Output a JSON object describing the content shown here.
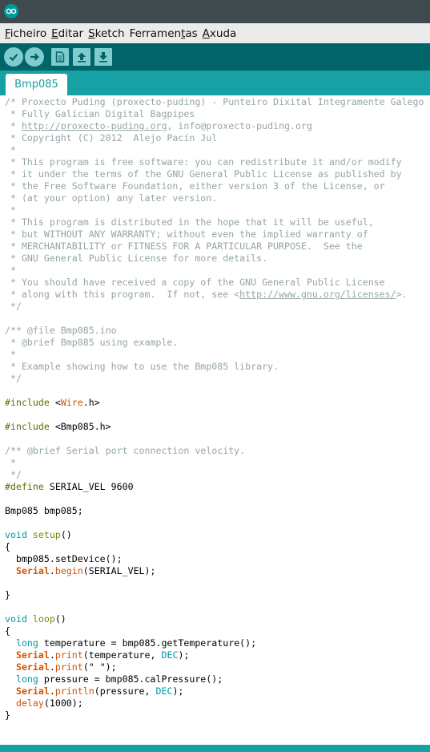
{
  "menu": {
    "items": [
      {
        "u": "F",
        "rest": "icheiro"
      },
      {
        "u": "E",
        "rest": "ditar"
      },
      {
        "u": "S",
        "rest": "ketch"
      },
      {
        "pre": "Ferramen",
        "u": "t",
        "rest": "as"
      },
      {
        "u": "A",
        "rest": "xuda"
      }
    ]
  },
  "tab": {
    "label": "Bmp085"
  },
  "code": [
    [
      [
        "c",
        "/* Proxecto Puding (proxecto-puding) - Punteiro Dixital Integramente Galego"
      ]
    ],
    [
      [
        "c",
        " * Fully Galician Digital Bagpipes"
      ]
    ],
    [
      [
        "c",
        " * "
      ],
      [
        "a",
        "http://proxecto-puding.org"
      ],
      [
        "c",
        ", info@proxecto-puding.org"
      ]
    ],
    [
      [
        "c",
        " * Copyright (C) 2012  Alejo Pacín Jul"
      ]
    ],
    [
      [
        "c",
        " *"
      ]
    ],
    [
      [
        "c",
        " * This program is free software: you can redistribute it and/or modify"
      ]
    ],
    [
      [
        "c",
        " * it under the terms of the GNU General Public License as published by"
      ]
    ],
    [
      [
        "c",
        " * the Free Software Foundation, either version 3 of the License, or"
      ]
    ],
    [
      [
        "c",
        " * (at your option) any later version."
      ]
    ],
    [
      [
        "c",
        " *"
      ]
    ],
    [
      [
        "c",
        " * This program is distributed in the hope that it will be useful,"
      ]
    ],
    [
      [
        "c",
        " * but WITHOUT ANY WARRANTY; without even the implied warranty of"
      ]
    ],
    [
      [
        "c",
        " * MERCHANTABILITY or FITNESS FOR A PARTICULAR PURPOSE.  See the"
      ]
    ],
    [
      [
        "c",
        " * GNU General Public License for more details."
      ]
    ],
    [
      [
        "c",
        " *"
      ]
    ],
    [
      [
        "c",
        " * You should have received a copy of the GNU General Public License"
      ]
    ],
    [
      [
        "c",
        " * along with this program.  If not, see <"
      ],
      [
        "a",
        "http://www.gnu.org/licenses/"
      ],
      [
        "c",
        ">."
      ]
    ],
    [
      [
        "c",
        " */"
      ]
    ],
    [],
    [
      [
        "c",
        "/** @file Bmp085.ino"
      ]
    ],
    [
      [
        "c",
        " * @brief Bmp085 using example."
      ]
    ],
    [
      [
        "c",
        " *"
      ]
    ],
    [
      [
        "c",
        " * Example showing how to use the Bmp085 library."
      ]
    ],
    [
      [
        "c",
        " */"
      ]
    ],
    [],
    [
      [
        "pre",
        "#include "
      ],
      [
        "t",
        "<"
      ],
      [
        "lib",
        "Wire"
      ],
      [
        "t",
        ".h>"
      ]
    ],
    [],
    [
      [
        "pre",
        "#include "
      ],
      [
        "t",
        "<Bmp085.h>"
      ]
    ],
    [],
    [
      [
        "c",
        "/** @brief Serial port connection velocity."
      ]
    ],
    [
      [
        "c",
        " *"
      ]
    ],
    [
      [
        "c",
        " */"
      ]
    ],
    [
      [
        "pre",
        "#define "
      ],
      [
        "t",
        "SERIAL_VEL 9600"
      ]
    ],
    [],
    [
      [
        "t",
        "Bmp085 bmp085;"
      ]
    ],
    [],
    [
      [
        "typ",
        "void "
      ],
      [
        "kw",
        "setup"
      ],
      [
        "t",
        "()"
      ]
    ],
    [
      [
        "t",
        "{"
      ]
    ],
    [
      [
        "t",
        "  bmp085.setDevice();"
      ]
    ],
    [
      [
        "t",
        "  "
      ],
      [
        "fnb",
        "Serial"
      ],
      [
        "t",
        "."
      ],
      [
        "fn",
        "begin"
      ],
      [
        "t",
        "(SERIAL_VEL);"
      ]
    ],
    [],
    [
      [
        "t",
        "}"
      ]
    ],
    [],
    [
      [
        "typ",
        "void "
      ],
      [
        "kw",
        "loop"
      ],
      [
        "t",
        "()"
      ]
    ],
    [
      [
        "t",
        "{"
      ]
    ],
    [
      [
        "t",
        "  "
      ],
      [
        "typ",
        "long"
      ],
      [
        "t",
        " temperature = bmp085.getTemperature();"
      ]
    ],
    [
      [
        "t",
        "  "
      ],
      [
        "fnb",
        "Serial"
      ],
      [
        "t",
        "."
      ],
      [
        "fn",
        "print"
      ],
      [
        "t",
        "(temperature, "
      ],
      [
        "typ",
        "DEC"
      ],
      [
        "t",
        ");"
      ]
    ],
    [
      [
        "t",
        "  "
      ],
      [
        "fnb",
        "Serial"
      ],
      [
        "t",
        "."
      ],
      [
        "fn",
        "print"
      ],
      [
        "t",
        "(\" \");"
      ]
    ],
    [
      [
        "t",
        "  "
      ],
      [
        "typ",
        "long"
      ],
      [
        "t",
        " pressure = bmp085.calPressure();"
      ]
    ],
    [
      [
        "t",
        "  "
      ],
      [
        "fnb",
        "Serial"
      ],
      [
        "t",
        "."
      ],
      [
        "fn",
        "println"
      ],
      [
        "t",
        "(pressure, "
      ],
      [
        "typ",
        "DEC"
      ],
      [
        "t",
        ");"
      ]
    ],
    [
      [
        "t",
        "  "
      ],
      [
        "fn",
        "delay"
      ],
      [
        "t",
        "(1000);"
      ]
    ],
    [
      [
        "t",
        "}"
      ]
    ]
  ]
}
